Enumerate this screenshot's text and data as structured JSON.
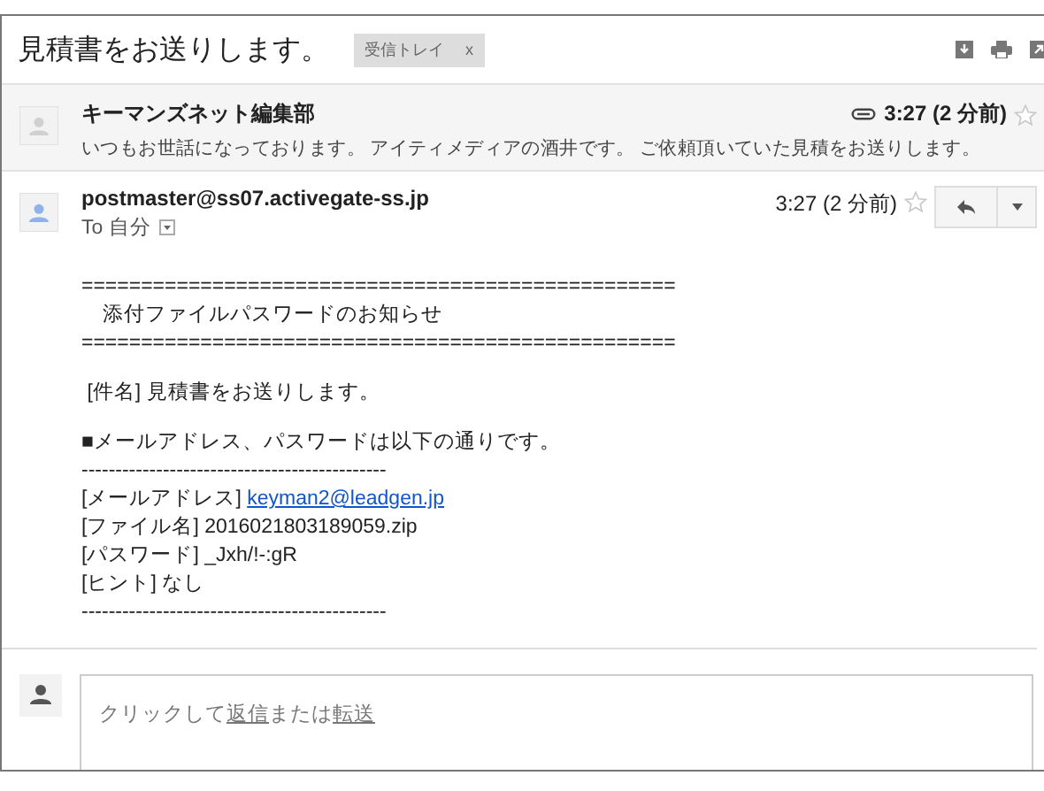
{
  "subject": "見積書をお送りします。",
  "label": {
    "text": "受信トレイ",
    "close": "x"
  },
  "collapsed": {
    "sender": "キーマンズネット編集部",
    "time": "3:27 (2 分前)",
    "starred": false,
    "snippet": "いつもお世話になっております。 アイティメディアの酒井です。 ご依頼頂いていた見積をお送りします。"
  },
  "message": {
    "sender": "postmaster@ss07.activegate-ss.jp",
    "to": "To 自分",
    "time": "3:27 (2 分前)",
    "starred": false,
    "body": [
      {
        "kind": "text",
        "text": "=================================================="
      },
      {
        "kind": "text",
        "text": "　添付ファイルパスワードのお知らせ"
      },
      {
        "kind": "text",
        "text": "=================================================="
      },
      {
        "kind": "blank"
      },
      {
        "kind": "text",
        "text": " [件名] 見積書をお送りします。"
      },
      {
        "kind": "blank"
      },
      {
        "kind": "text",
        "text": "■メールアドレス、パスワードは以下の通りです。"
      },
      {
        "kind": "text",
        "text": "---------------------------------------------"
      },
      {
        "kind": "link",
        "text": "[メールアドレス]",
        "link": "keyman2@leadgen.jp"
      },
      {
        "kind": "text",
        "text": "[ファイル名] 2016021803189059.zip"
      },
      {
        "kind": "text",
        "text": "[パスワード] _Jxh/!-:gR"
      },
      {
        "kind": "text",
        "text": "[ヒント] なし"
      },
      {
        "kind": "text",
        "text": "---------------------------------------------"
      }
    ]
  },
  "reply": [
    {
      "kind": "text",
      "text": "クリックして"
    },
    {
      "kind": "link",
      "text": "返信"
    },
    {
      "kind": "text",
      "text": "または"
    },
    {
      "kind": "link",
      "text": "転送"
    }
  ]
}
